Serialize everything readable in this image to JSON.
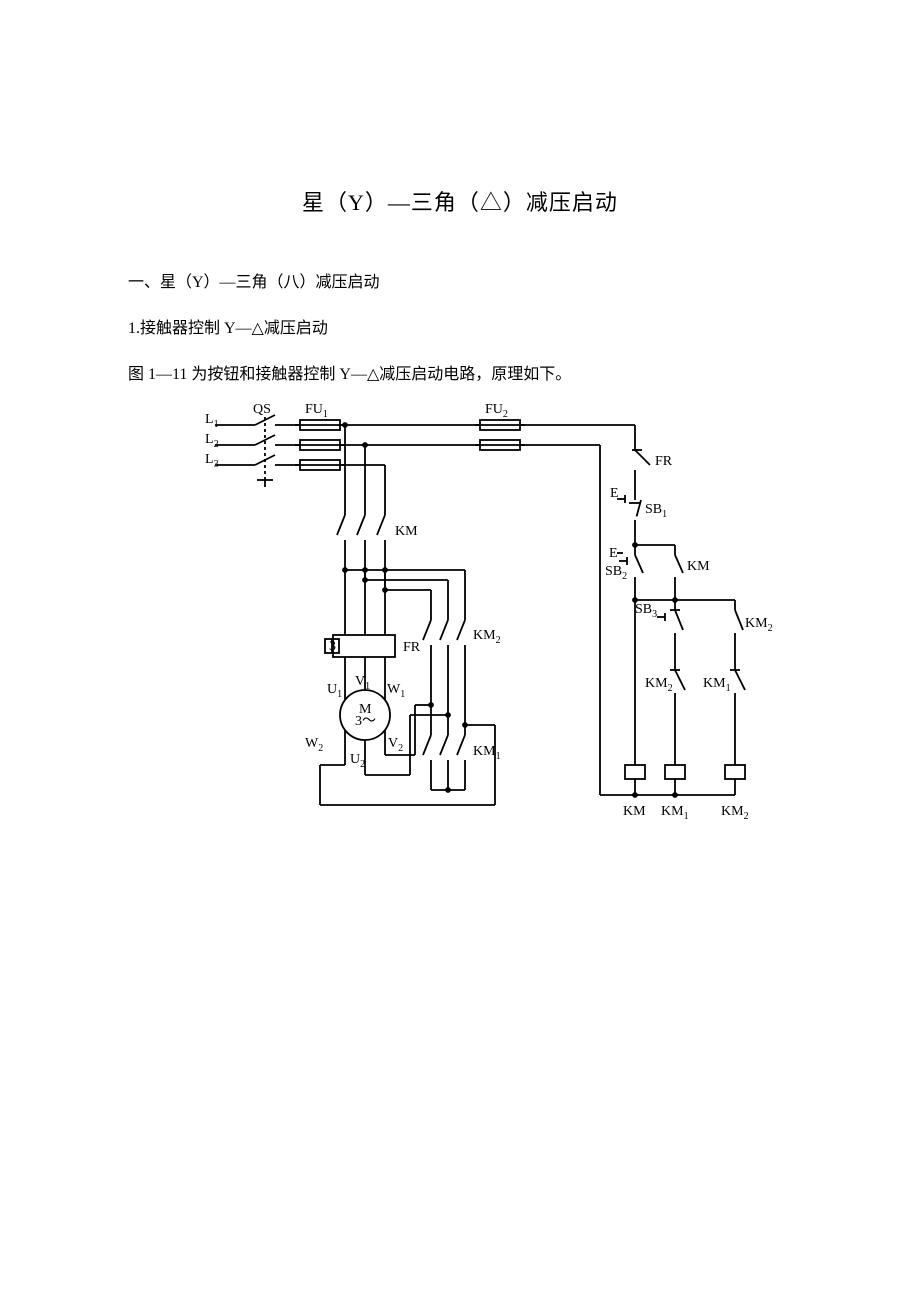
{
  "title": "星（Y）—三角（△）减压启动",
  "section1": "一、星（Y）—三角（八）减压启动",
  "subsection1": "1.接触器控制 Y—△减压启动",
  "figure_intro": "图 1—11 为按钮和接触器控制 Y—△减压启动电路，原理如下。",
  "labels": {
    "L1": "L",
    "L1s": "1",
    "L2": "L",
    "L2s": "2",
    "L3": "L",
    "L3s": "3",
    "QS": "QS",
    "FU1": "FU",
    "FU1s": "1",
    "FU2": "FU",
    "FU2s": "2",
    "FR": "FR",
    "SB1": "SB",
    "SB1s": "1",
    "SB2": "SB",
    "SB2s": "2",
    "SB3": "SB",
    "SB3s": "3",
    "KM": "KM",
    "KM1": "KM",
    "KM1s": "1",
    "KM2": "KM",
    "KM2s": "2",
    "E": "E",
    "three": "3",
    "M": "M",
    "M3": "3～",
    "U1": "U",
    "U1s": "1",
    "V1": "V",
    "V1s": "1",
    "W1": "W",
    "W1s": "1",
    "U2": "U",
    "U2s": "2",
    "V2": "V",
    "V2s": "2",
    "W2": "W",
    "W2s": "2"
  }
}
